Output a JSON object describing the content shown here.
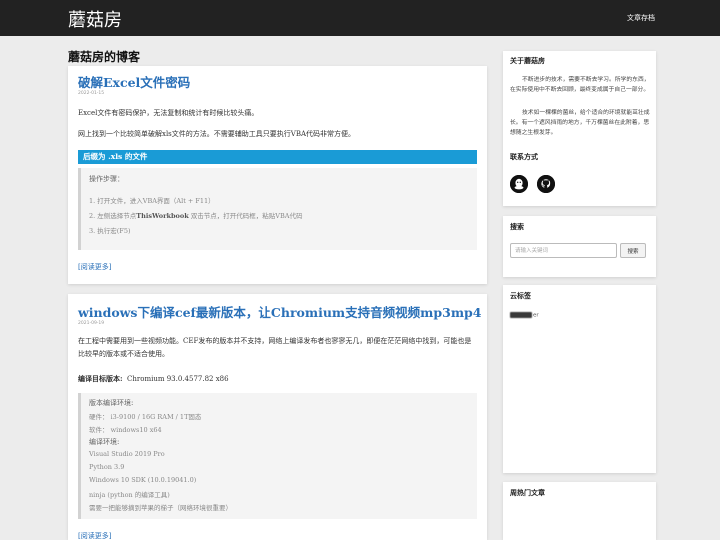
{
  "header": {
    "site_title": "蘑菇房",
    "nav_archive": "文章存档"
  },
  "main": {
    "heading": "蘑菇房的博客",
    "posts": [
      {
        "title": "破解Excel文件密码",
        "date": "2022-01-15",
        "paragraphs": [
          "Excel文件有密码保护，无法复制和统计有时候比较头痛。",
          "网上找到一个比较简单破解xls文件的方法。不需要辅助工具只要执行VBA代码非常方便。"
        ],
        "section_heading": "后缀为 .xls 的文件",
        "quote": {
          "label": "操作步骤：",
          "steps": [
            "1. 打开文件，进入VBA界面（Alt + F11）",
            "2. 左侧选择节点",
            "ThisWorkbook",
            " 双击节点，打开代码框，粘贴VBA代码",
            "3. 执行宏(F5)"
          ]
        },
        "read_more": "[阅读更多]"
      },
      {
        "title": "windows下编译cef最新版本，让Chromium支持音频视频mp3mp4",
        "date": "2021-09-19",
        "paragraphs": [
          "在工程中需要用到一些视频功能。CEF发布的版本并不支持，网络上编译发布者也寥寥无几，即便在茫茫网络中找到，可能也是比较早的版本或不适合使用。"
        ],
        "target_label": "编译目标版本:",
        "target_value": "Chromium 93.0.4577.82 x86",
        "quote": {
          "lines": [
            "版本编译环境:",
            "硬件：  i3-9100 / 16G RAM / 1T固态",
            "软件：  windows10 x64",
            "编译环境:",
            "Visual Studio 2019 Pro",
            "Python 3.9",
            "Windows 10 SDK (10.0.19041.0)",
            "ninja (python 的编译工具)",
            "需要一把能够摘到苹果的梯子（网络环境很重要）"
          ]
        },
        "read_more": "[阅读更多]"
      }
    ]
  },
  "sidebar": {
    "about": {
      "title": "关于蘑菇房",
      "paragraphs": [
        "不断进步的技术，需要不断去学习。所学的东西，在实际使用中不断去回顾，最终变成属于自己一部分。",
        "技术如一棵棵的菌丝，给个适合的环境就能茁壮成长。有一个遮风挡雨的地方，千万棵菌丝在此附着，思想随之生根发芽。"
      ]
    },
    "contact": {
      "title": "联系方式",
      "icons": [
        "qq-icon",
        "github-icon"
      ]
    },
    "search": {
      "title": "搜索",
      "placeholder": "请输入关键词",
      "button": "搜索"
    },
    "tags": {
      "title": "云标签",
      "items": [
        "er"
      ]
    },
    "hot": {
      "title": "周热门文章"
    }
  }
}
